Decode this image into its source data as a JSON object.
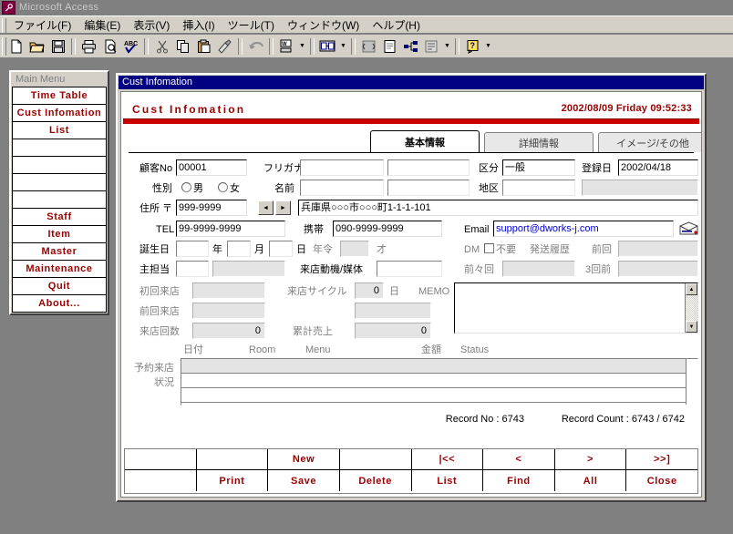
{
  "titlebar": {
    "app_name": "Microsoft Access",
    "icon": "access-key-icon"
  },
  "menubar": {
    "items": [
      {
        "label": "ファイル(F)"
      },
      {
        "label": "編集(E)"
      },
      {
        "label": "表示(V)"
      },
      {
        "label": "挿入(I)"
      },
      {
        "label": "ツール(T)"
      },
      {
        "label": "ウィンドウ(W)"
      },
      {
        "label": "ヘルプ(H)"
      }
    ]
  },
  "toolbar": {
    "buttons": [
      {
        "name": "new-icon",
        "glyph": "page"
      },
      {
        "name": "open-folder-icon",
        "glyph": "folder"
      },
      {
        "name": "save-disk-icon",
        "glyph": "disk"
      },
      {
        "name": "print-icon",
        "glyph": "printer"
      },
      {
        "name": "print-preview-icon",
        "glyph": "preview"
      },
      {
        "name": "spelling-check-icon",
        "glyph": "abc"
      },
      {
        "name": "cut-scissors-icon",
        "glyph": "scissors"
      },
      {
        "name": "copy-icon",
        "glyph": "copy"
      },
      {
        "name": "paste-icon",
        "glyph": "clipboard"
      },
      {
        "name": "format-painter-icon",
        "glyph": "brush"
      },
      {
        "name": "undo-icon",
        "glyph": "undo"
      },
      {
        "name": "office-links-icon",
        "glyph": "links"
      },
      {
        "name": "analyze-icon",
        "glyph": "analyze"
      },
      {
        "name": "code-icon",
        "glyph": "code"
      },
      {
        "name": "properties-icon",
        "glyph": "properties"
      },
      {
        "name": "relationships-icon",
        "glyph": "relationships"
      },
      {
        "name": "new-object-icon",
        "glyph": "newobj"
      },
      {
        "name": "help-icon",
        "glyph": "help"
      }
    ]
  },
  "main_menu": {
    "title": "Main Menu",
    "items": [
      {
        "label": "Time Table",
        "blank": false
      },
      {
        "label": "Cust Infomation",
        "blank": false
      },
      {
        "label": "List",
        "blank": false
      },
      {
        "label": "",
        "blank": true
      },
      {
        "label": "",
        "blank": true
      },
      {
        "label": "",
        "blank": true
      },
      {
        "label": "",
        "blank": true
      },
      {
        "label": "Staff",
        "blank": false
      },
      {
        "label": "Item",
        "blank": false
      },
      {
        "label": "Master",
        "blank": false
      },
      {
        "label": "Maintenance",
        "blank": false
      },
      {
        "label": "Quit",
        "blank": false
      },
      {
        "label": "About...",
        "blank": false
      }
    ]
  },
  "form": {
    "window_title": "Cust Infomation",
    "heading": "Cust Infomation",
    "datetime": "2002/08/09 Friday 09:52:33",
    "accent_color": "#cc0000",
    "title_bar_color": "#000080",
    "tabs": [
      {
        "label": "基本情報",
        "active": true
      },
      {
        "label": "詳細情報",
        "active": false
      },
      {
        "label": "イメージ/その他",
        "active": false
      }
    ],
    "fields": {
      "cust_no_label": "顧客No",
      "cust_no_value": "00001",
      "furigana_label": "フリガナ",
      "furigana_value1": "",
      "furigana_value2": "",
      "kubun_label": "区分",
      "kubun_value": "一般",
      "touroku_label": "登録日",
      "touroku_value": "2002/04/18",
      "seibetsu_label": "性別",
      "seibetsu_male": "男",
      "seibetsu_female": "女",
      "namae_label": "名前",
      "namae_value1": "",
      "namae_value2": "",
      "chiku_label": "地区",
      "chiku_value": "",
      "chiku_value2": "",
      "juusho_label": "住所 〒",
      "zip_value": "999-9999",
      "address_value": "兵庫県○○○市○○○町1-1-1-101",
      "tel_label": "TEL",
      "tel_value": "99-9999-9999",
      "keitai_label": "携帯",
      "keitai_value": "090-9999-9999",
      "email_label": "Email",
      "email_value": "support@dworks-j.com",
      "tanjoubi_label": "誕生日",
      "tanjoubi_year": "",
      "tanjoubi_year_unit": "年",
      "tanjoubi_month": "",
      "tanjoubi_month_unit": "月",
      "tanjoubi_day": "",
      "tanjoubi_day_unit": "日",
      "nenrei_label": "年令",
      "nenrei_value": "",
      "nenrei_unit": "才",
      "dm_label": "DM",
      "dm_fuyou": "不要",
      "hassou_rireki": "発送履歴",
      "zenkai_label": "前回",
      "zenkai_value": "",
      "shu_tantou_label": "主担当",
      "shu_tantou_value": "",
      "shu_tantou_name": "",
      "douki_label": "来店動機/媒体",
      "douki_value": "",
      "zenzenkai_label": "前々回",
      "zenzenkai_value": "",
      "sankaimae_label": "3回前",
      "sankaimae_value": "",
      "shokai_raiten_label": "初回来店",
      "shokai_raiten_value": "",
      "raiten_cycle_label": "来店サイクル",
      "raiten_cycle_value": "0",
      "raiten_cycle_unit": "日",
      "memo_label": "MEMO",
      "memo_value": "",
      "zenkai_raiten_label": "前回来店",
      "zenkai_raiten_value": "",
      "zenkai_raiten_value2": "",
      "raiten_kaisuu_label": "来店回数",
      "raiten_kaisuu_value": "0",
      "ruikei_uriage_label": "累計売上",
      "ruikei_uriage_value": "0"
    },
    "reservation": {
      "row_label_line1": "予約来店",
      "row_label_line2": "状況",
      "columns": [
        "日付",
        "Room",
        "Menu",
        "金額",
        "Status"
      ],
      "rows": [
        {
          "date": "",
          "room": "",
          "menu": "",
          "amount": "",
          "status": "",
          "selected": true
        },
        {
          "date": "",
          "room": "",
          "menu": "",
          "amount": "",
          "status": "",
          "selected": false
        },
        {
          "date": "",
          "room": "",
          "menu": "",
          "amount": "",
          "status": "",
          "selected": false
        }
      ]
    },
    "status": {
      "record_no": "Record No : 6743",
      "record_count": "Record Count : 6743 / 6742"
    },
    "commands": {
      "row1": [
        "",
        "",
        "New",
        "",
        "|<<",
        "<",
        ">",
        ">>]"
      ],
      "row2": [
        "",
        "Print",
        "Save",
        "Delete",
        "List",
        "Find",
        "All",
        "Close"
      ]
    }
  }
}
